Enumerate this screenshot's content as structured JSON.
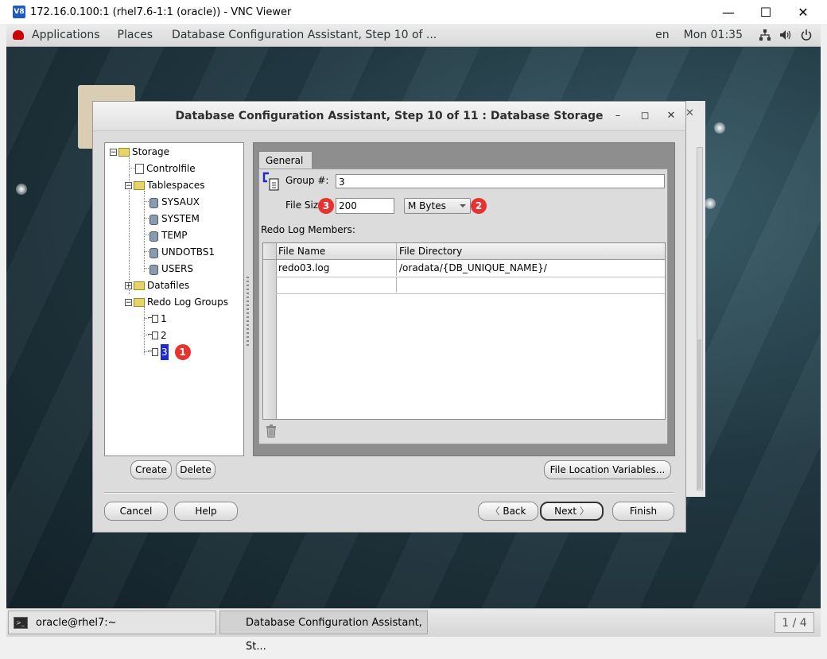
{
  "vnc": {
    "logo": "V8",
    "title": "172.16.0.100:1 (rhel7.6-1:1 (oracle)) - VNC Viewer",
    "minimize": "—",
    "maximize": "☐",
    "close": "✕"
  },
  "topbar": {
    "applications": "Applications",
    "places": "Places",
    "active_task": "Database Configuration Assistant, Step 10 of ...",
    "lang": "en",
    "clock": "Mon 01:35",
    "network_icon": "network-icon",
    "volume_icon": "volume-icon",
    "power_icon": "power-icon"
  },
  "back_window": {
    "close": "✕"
  },
  "dialog": {
    "title": "Database Configuration Assistant, Step 10 of 11 : Database Storage",
    "minimize": "–",
    "maximize": "◻",
    "close": "✕",
    "tree": {
      "storage": "Storage",
      "controlfile": "Controlfile",
      "tablespaces": "Tablespaces",
      "sysaux": "SYSAUX",
      "system": "SYSTEM",
      "temp": "TEMP",
      "undotbs1": "UNDOTBS1",
      "users": "USERS",
      "datafiles": "Datafiles",
      "redo_log_groups": "Redo Log Groups",
      "group1": "1",
      "group2": "2",
      "group3": "3",
      "expanded_symbol": "−",
      "collapsed_symbol": "+"
    },
    "tab_general": "General",
    "group_label": "Group #:",
    "group_value": "3",
    "file_size_label": "File Size",
    "file_size_value": "200",
    "unit_value": "M Bytes",
    "redo_members_label": "Redo Log Members:",
    "table": {
      "headers": [
        "File Name",
        "File Directory"
      ],
      "rows": [
        [
          "redo03.log",
          "/oradata/{DB_UNIQUE_NAME}/"
        ]
      ]
    },
    "badges": {
      "one": "1",
      "two": "2",
      "three": "3"
    },
    "buttons": {
      "create": "Create",
      "delete": "Delete",
      "file_location_variables": "File Location Variables...",
      "cancel": "Cancel",
      "help": "Help",
      "back": "Back",
      "next": "Next",
      "finish": "Finish",
      "back_arrow": "〈",
      "next_arrow": "〉"
    }
  },
  "taskbar": {
    "terminal_icon_text": ">_",
    "terminal": "oracle@rhel7:~",
    "dbca": "Database Configuration Assistant, St...",
    "pager": "1 / 4"
  },
  "colors": {
    "selection": "#1c2ad0",
    "badge": "#e8322f",
    "dialog_bg": "#dcdcdc",
    "panel_dark": "#8e8e8e"
  }
}
